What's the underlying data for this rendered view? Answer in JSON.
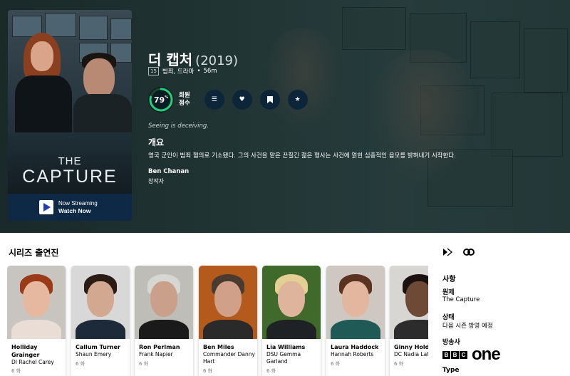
{
  "show": {
    "title": "더 캡처",
    "year": "(2019)",
    "certification": "15",
    "genres": "범죄, 드라마",
    "runtime": "56m",
    "score": "79",
    "score_unit": "%",
    "score_fraction": 0.79,
    "score_label_1": "회원",
    "score_label_2": "점수",
    "tagline": "Seeing is deceiving.",
    "overview_heading": "개요",
    "overview": "영국 군인이 범죄 혐의로 기소됐다. 그의 사건을 맡은 끈질긴 젊은 형사는 사건에 얽힌 심층적인 음모를 밝혀내기 시작한다.",
    "creator_name": "Ben Chanan",
    "creator_role": "창작자"
  },
  "poster": {
    "title_line1": "THE",
    "title_line2": "CAPTURE",
    "stream_line1": "Now Streaming",
    "stream_line2": "Watch Now"
  },
  "actions": {
    "list_icon": "list-icon",
    "favorite_icon": "heart-icon",
    "watchlist_icon": "bookmark-icon",
    "rate_icon": "star-icon"
  },
  "cast_section_title": "시리즈 출연진",
  "cast": [
    {
      "name": "Holliday Grainger",
      "role": "DI Rachel Carey",
      "episodes": "6 화"
    },
    {
      "name": "Callum Turner",
      "role": "Shaun Emery",
      "episodes": "6 화"
    },
    {
      "name": "Ron Perlman",
      "role": "Frank Napier",
      "episodes": "6 화"
    },
    {
      "name": "Ben Miles",
      "role": "Commander Danny Hart",
      "episodes": "6 화"
    },
    {
      "name": "Lia Williams",
      "role": "DSU Gemma Garland",
      "episodes": "6 화"
    },
    {
      "name": "Laura Haddock",
      "role": "Hannah Roberts",
      "episodes": "6 화"
    },
    {
      "name": "Ginny Holder",
      "role": "DC Nadia Latif",
      "episodes": "6 화"
    }
  ],
  "sidebar": {
    "facts_heading": "사항",
    "original_title_label": "원제",
    "original_title": "The Capture",
    "status_label": "상태",
    "status": "다음 시즌 방영 예정",
    "network_label": "방송사",
    "network_logo_text": "BBC",
    "network_logo_b1": "B",
    "network_logo_b2": "B",
    "network_logo_c": "C",
    "network_logo_one": "one",
    "type_label": "Type"
  },
  "colors": {
    "score_ring": "#21d07a",
    "score_track": "#204529",
    "stream_bar": "#0e2946",
    "action_button": "#0c2538"
  }
}
